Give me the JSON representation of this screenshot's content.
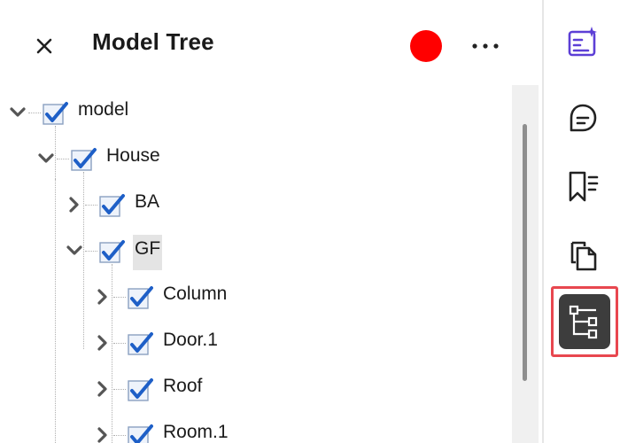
{
  "header": {
    "title": "Model Tree",
    "record_color": "#ff0000"
  },
  "tree": {
    "nodes": [
      {
        "label": "model",
        "level": 0,
        "expanded": true,
        "checked": true,
        "selected": false
      },
      {
        "label": "House",
        "level": 1,
        "expanded": true,
        "checked": true,
        "selected": false
      },
      {
        "label": "BA",
        "level": 2,
        "expanded": false,
        "checked": true,
        "selected": false
      },
      {
        "label": "GF",
        "level": 2,
        "expanded": true,
        "checked": true,
        "selected": true
      },
      {
        "label": "Column",
        "level": 3,
        "expanded": false,
        "checked": true,
        "selected": false
      },
      {
        "label": "Door.1",
        "level": 3,
        "expanded": false,
        "checked": true,
        "selected": false
      },
      {
        "label": "Roof",
        "level": 3,
        "expanded": false,
        "checked": true,
        "selected": false
      },
      {
        "label": "Room.1",
        "level": 3,
        "expanded": false,
        "checked": true,
        "selected": false
      }
    ]
  },
  "rail": {
    "items": [
      {
        "name": "edit-ai-icon",
        "active": false
      },
      {
        "name": "comment-icon",
        "active": false
      },
      {
        "name": "bookmark-icon",
        "active": false
      },
      {
        "name": "pages-icon",
        "active": false
      },
      {
        "name": "model-tree-icon",
        "active": true
      }
    ]
  },
  "colors": {
    "accent_purple": "#5c3fd6",
    "active_outline": "#e8474f",
    "active_bg": "#3d3d3d",
    "check_blue": "#1e5fc7"
  }
}
